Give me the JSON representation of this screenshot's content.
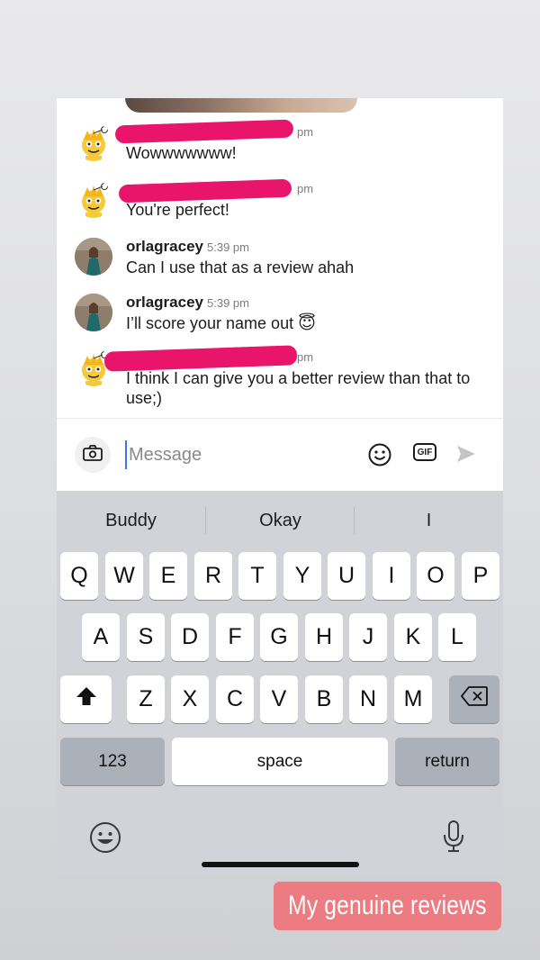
{
  "messages": [
    {
      "username": "",
      "time": "pm",
      "text": "Wowwwwwww!",
      "avatar": "snoo-avatar"
    },
    {
      "username": "",
      "time": "pm",
      "text": "You're perfect!",
      "avatar": "snoo-avatar"
    },
    {
      "username": "orlagracey",
      "time": "5:39 pm",
      "text": "Can I use that as a review ahah",
      "avatar": "profile-photo"
    },
    {
      "username": "orlagracey",
      "time": "5:39 pm",
      "text": "I’ll score your name out",
      "emoji": "😇",
      "avatar": "profile-photo"
    },
    {
      "username": "",
      "time": "pm",
      "text": "I think I can give you a better review than that to use;)",
      "avatar": "snoo-avatar"
    }
  ],
  "compose": {
    "placeholder": "Message",
    "gif_label": "GIF",
    "icons": [
      "camera-icon",
      "emoji-icon",
      "gif-icon",
      "send-icon"
    ]
  },
  "keyboard": {
    "suggestions": [
      "Buddy",
      "Okay",
      "I"
    ],
    "row1": [
      "Q",
      "W",
      "E",
      "R",
      "T",
      "Y",
      "U",
      "I",
      "O",
      "P"
    ],
    "row2": [
      "A",
      "S",
      "D",
      "F",
      "G",
      "H",
      "J",
      "K",
      "L"
    ],
    "row3": [
      "Z",
      "X",
      "C",
      "V",
      "B",
      "N",
      "M"
    ],
    "numbers_label": "123",
    "space_label": "space",
    "return_label": "return",
    "icons": [
      "shift-icon",
      "backspace-icon",
      "emoji-keyboard-icon",
      "microphone-icon"
    ]
  },
  "sticker": {
    "text": "My genuine reviews",
    "color": "#ec7b82"
  },
  "colors": {
    "redaction": "#e8156b",
    "send_disabled": "#c4c4c6",
    "cursor": "#3478f6"
  }
}
